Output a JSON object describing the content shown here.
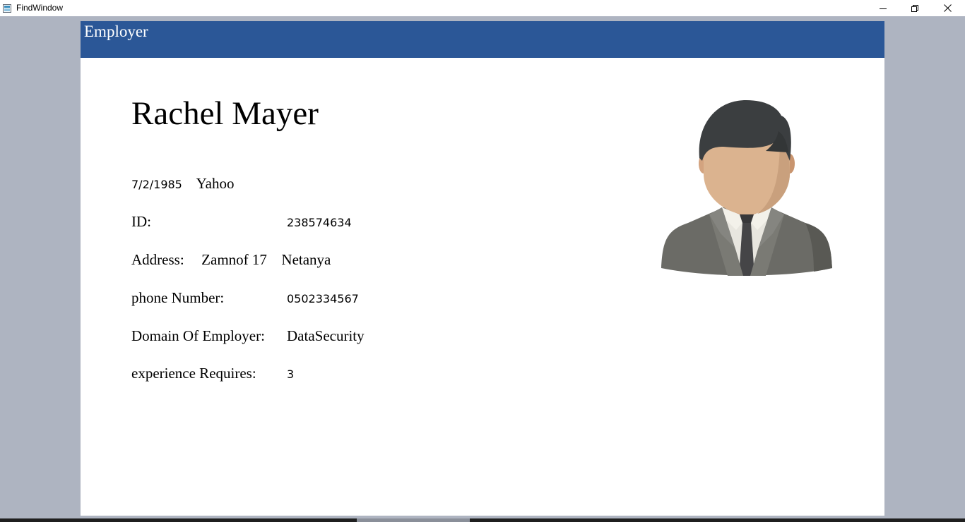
{
  "window": {
    "title": "FindWindow"
  },
  "header": {
    "title": "Employer"
  },
  "employer": {
    "name": "Rachel Mayer",
    "date": "7/2/1985",
    "company": "Yahoo",
    "id_label": "ID:",
    "id_value": "238574634",
    "address_label": "Address:",
    "address_street": "Zamnof 17",
    "address_city": "Netanya",
    "phone_label": "phone Number:",
    "phone_value": "0502334567",
    "domain_label": "Domain Of Employer:",
    "domain_value": "DataSecurity",
    "experience_label": "experience Requires:",
    "experience_value": "3"
  },
  "icons": {
    "app": "window-app-icon",
    "minimize": "minimize-icon",
    "maximize": "restore-icon",
    "close": "close-icon",
    "avatar": "businessman-avatar-icon"
  }
}
